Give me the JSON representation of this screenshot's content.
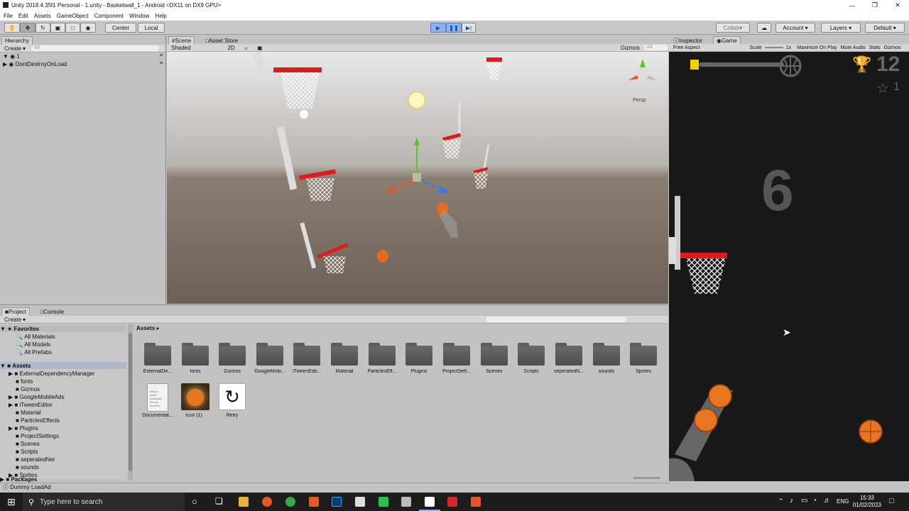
{
  "app": {
    "title": "Unity 2018.4.35f1 Personal - 1.unity - Basketwall_1 - Android <DX11 on DX9 GPU>",
    "menu": [
      "File",
      "Edit",
      "Assets",
      "GameObject",
      "Component",
      "Window",
      "Help"
    ]
  },
  "toolbar": {
    "center": "Center",
    "local": "Local",
    "collab": "Collab",
    "account": "Account",
    "layers": "Layers",
    "layout": "Default"
  },
  "hierarchy": {
    "tab": "Hierarchy",
    "create": "Create",
    "search": "All",
    "items": [
      "1",
      "DontDestroyOnLoad"
    ]
  },
  "scene": {
    "tabs": [
      "Scene",
      "Asset Store"
    ],
    "shading": "Shaded",
    "mode2d": "2D",
    "gizmos": "Gizmos",
    "search": "All",
    "persp": "Persp"
  },
  "game": {
    "tabs": [
      "Inspector",
      "Game"
    ],
    "aspect": "Free Aspect",
    "scale_label": "Scale",
    "scale_value": "1x",
    "options": [
      "Maximize On Play",
      "Mute Audio",
      "Stats",
      "Gizmos"
    ],
    "best": "12",
    "stars": "1",
    "score": "6"
  },
  "project": {
    "tabs": [
      "Project",
      "Console"
    ],
    "create": "Create",
    "breadcrumb": "Assets",
    "favorites_label": "Favorites",
    "favorites": [
      "All Materials",
      "All Models",
      "All Prefabs"
    ],
    "assets_label": "Assets",
    "tree": [
      "ExternalDependencyManager",
      "fonts",
      "Gizmos",
      "GoogleMobileAds",
      "iTweenEditor",
      "Material",
      "ParticlesEffects",
      "Plugins",
      "ProjectSettings",
      "Scenes",
      "Scripts",
      "seperatedNet",
      "sounds",
      "Sprites"
    ],
    "packages": "Packages",
    "folders": [
      "ExternalDe...",
      "fonts",
      "Gizmos",
      "GoogleMobi...",
      "iTweenEdit...",
      "Material",
      "ParticlesEff...",
      "Plugins",
      "ProjectSett...",
      "Scenes",
      "Scripts",
      "seperatedN...",
      "sounds",
      "Sprites"
    ],
    "files": [
      "Documentat...",
      "Icon (1)",
      "Retry"
    ],
    "doc_text": "Neque porro quisquam est qui dolorem"
  },
  "status": "Dummy LoadAd",
  "taskbar": {
    "search": "Type here to search",
    "lang": "ENG",
    "time": "15:33",
    "date": "01/02/2023"
  }
}
